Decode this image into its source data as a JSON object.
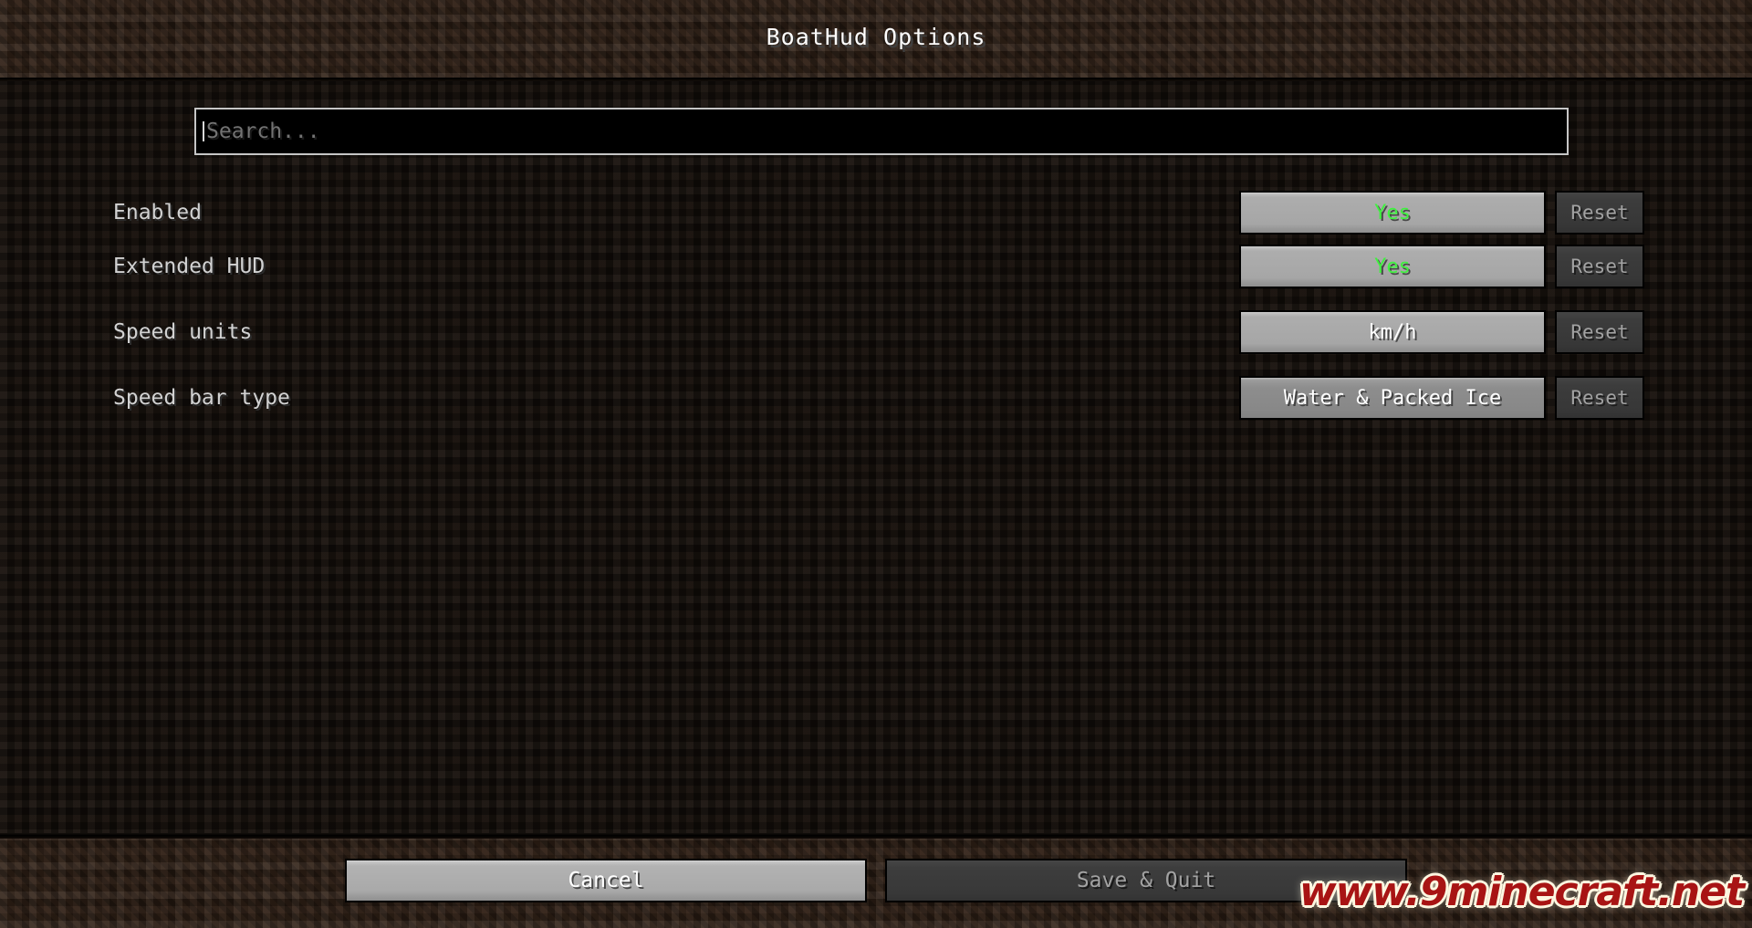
{
  "window": {
    "title": "BoatHud Options"
  },
  "search": {
    "placeholder": "Search...",
    "value": ""
  },
  "options": [
    {
      "label": "Enabled",
      "value": "Yes",
      "value_color": "#3ff23f",
      "reset_label": "Reset",
      "style": "raised"
    },
    {
      "label": "Extended HUD",
      "value": "Yes",
      "value_color": "#3ff23f",
      "reset_label": "Reset",
      "style": "raised"
    },
    {
      "label": "Speed units",
      "value": "km/h",
      "value_color": "#ffffff",
      "reset_label": "Reset",
      "style": "raised"
    },
    {
      "label": "Speed bar type",
      "value": "Water & Packed Ice",
      "value_color": "#ffffff",
      "reset_label": "Reset",
      "style": "flat"
    }
  ],
  "footer": {
    "cancel_label": "Cancel",
    "save_label": "Save & Quit"
  },
  "watermark": {
    "text": "www.9minecraft.net",
    "color": "#a81414"
  }
}
